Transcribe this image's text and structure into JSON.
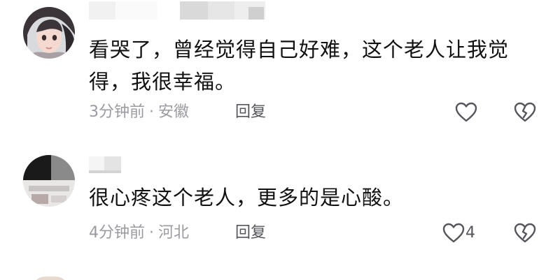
{
  "comments": [
    {
      "avatar_icon": "user-avatar-icon",
      "username": "",
      "text": "看哭了，曾经觉得自己好难，这个老人让我觉得，我很幸福。",
      "time": "3分钟前",
      "separator": "·",
      "location": "安徽",
      "reply_label": "回复",
      "like_icon": "heart-outline-icon",
      "like_count": "",
      "dislike_icon": "broken-heart-icon"
    },
    {
      "avatar_icon": "user-avatar-icon",
      "username": "",
      "text": "很心疼这个老人，更多的是心酸。",
      "time": "4分钟前",
      "separator": "·",
      "location": "河北",
      "reply_label": "回复",
      "like_icon": "heart-outline-icon",
      "like_count": "4",
      "dislike_icon": "broken-heart-icon"
    }
  ],
  "colors": {
    "text_primary": "#111111",
    "text_meta": "#9a9ba1",
    "text_action": "#55565c",
    "icon_stroke": "#55565c"
  }
}
